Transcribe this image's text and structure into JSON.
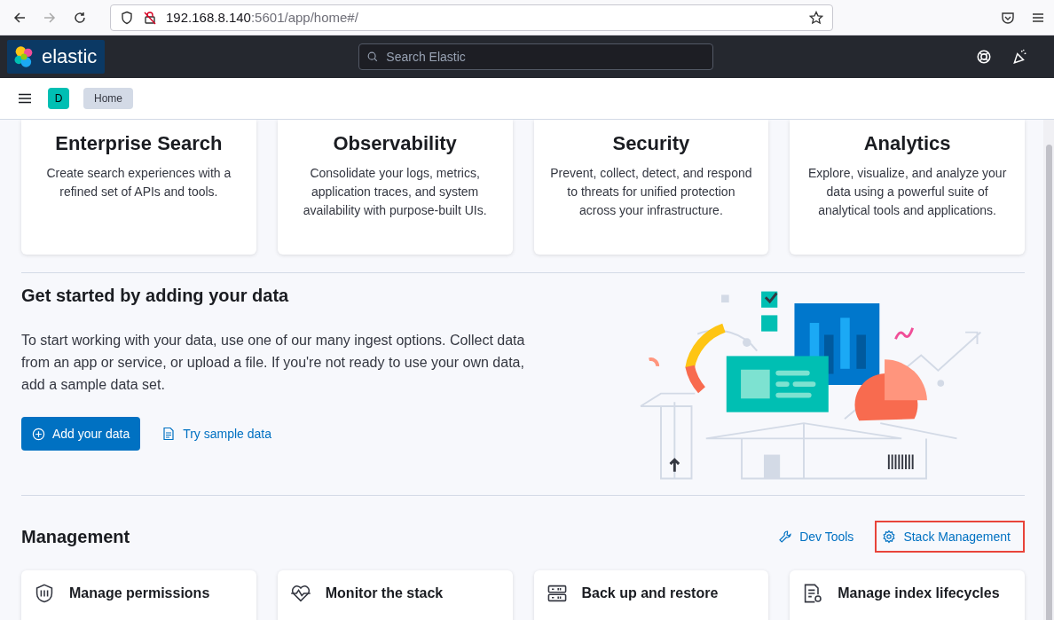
{
  "browser": {
    "url_host": "192.168.8.140",
    "url_rest": ":5601/app/home#/"
  },
  "header": {
    "logo": "elastic",
    "search": {
      "placeholder": "Search Elastic"
    }
  },
  "breadcrumbs": {
    "avatar": "D",
    "items": [
      "Home"
    ]
  },
  "solutions": [
    {
      "title": "Enterprise Search",
      "description": "Create search experiences with a refined set of APIs and tools."
    },
    {
      "title": "Observability",
      "description": "Consolidate your logs, metrics, application traces, and system availability with purpose-built UIs."
    },
    {
      "title": "Security",
      "description": "Prevent, collect, detect, and respond to threats for unified protection across your infrastructure."
    },
    {
      "title": "Analytics",
      "description": "Explore, visualize, and analyze your data using a powerful suite of analytical tools and applications."
    }
  ],
  "get_started": {
    "title": "Get started by adding your data",
    "text": "To start working with your data, use one of our many ingest options. Collect data from an app or service, or upload a file. If you're not ready to use your own data, add a sample data set.",
    "primary_button": "Add your data",
    "secondary_link": "Try sample data"
  },
  "management": {
    "title": "Management",
    "links": [
      {
        "label": "Dev Tools",
        "kind": "wrench",
        "highlighted": false
      },
      {
        "label": "Stack Management",
        "kind": "gear",
        "highlighted": true
      }
    ],
    "cards": [
      {
        "title": "Manage permissions",
        "kind": "shield"
      },
      {
        "title": "Monitor the stack",
        "kind": "heart"
      },
      {
        "title": "Back up and restore",
        "kind": "server"
      },
      {
        "title": "Manage index lifecycles",
        "kind": "doc"
      }
    ]
  }
}
